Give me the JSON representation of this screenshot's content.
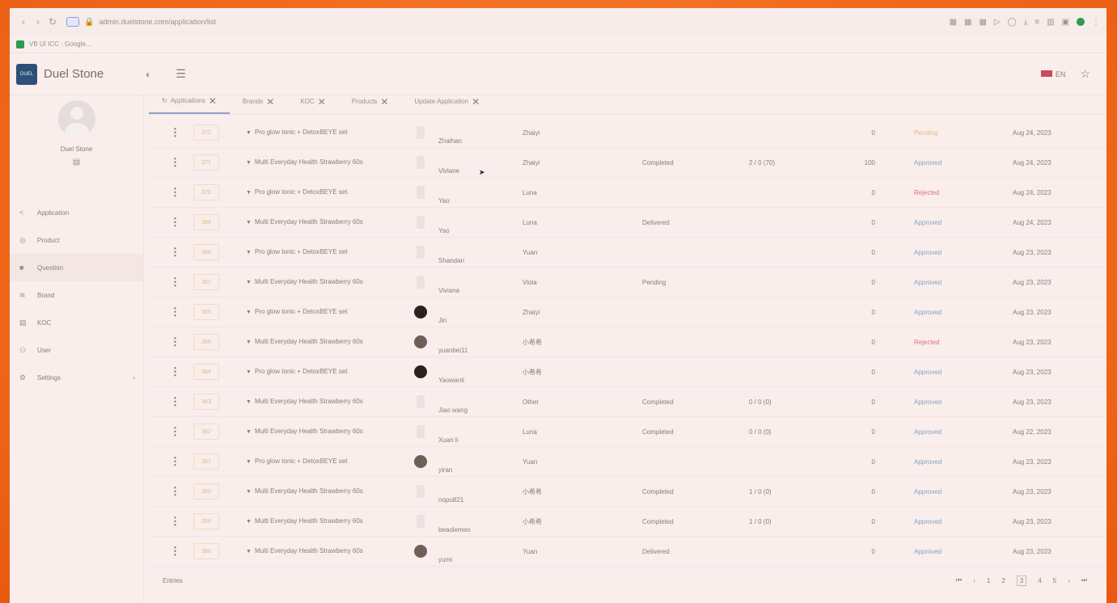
{
  "browser": {
    "url": "admin.duelstone.com/application/list",
    "bookmark": "VB UI ICC - Google..."
  },
  "app": {
    "name": "Duel Stone",
    "logo": "DUEL"
  },
  "header": {
    "lang": "EN"
  },
  "profile": {
    "name": "Duel Stone"
  },
  "sidebar": {
    "items": [
      {
        "label": "Application",
        "icon": "<"
      },
      {
        "label": "Product",
        "icon": "◎"
      },
      {
        "label": "Question",
        "icon": "■"
      },
      {
        "label": "Brand",
        "icon": "≋"
      },
      {
        "label": "KOC",
        "icon": "▤"
      },
      {
        "label": "User",
        "icon": "⚇"
      },
      {
        "label": "Settings",
        "icon": "⚙"
      }
    ]
  },
  "tabs": [
    "Applications",
    "Brands",
    "KOC",
    "Products",
    "Update Application"
  ],
  "rows": [
    {
      "id": "372",
      "product": "Pro glow tonic + DetoxBEYE set",
      "avatar": "bottle",
      "user": "Zhaihan",
      "agent": "Zhaiyi",
      "status": "",
      "progress": "",
      "count": "0",
      "approval": "Pending",
      "ap_class": "st-pending",
      "date": "Aug 24, 2023"
    },
    {
      "id": "371",
      "product": "Multi Everyday Health Strawberry 60s",
      "avatar": "bottle",
      "user": "Vivlane",
      "agent": "Zhaiyi",
      "status": "Completed",
      "progress": "2 / 0 (70)",
      "count": "100",
      "approval": "Approved",
      "ap_class": "st-approved",
      "date": "Aug 24, 2023"
    },
    {
      "id": "370",
      "product": "Pro glow tonic + DetoxBEYE set",
      "avatar": "bottle",
      "user": "Yao",
      "agent": "Luna",
      "status": "",
      "progress": "",
      "count": "0",
      "approval": "Rejected",
      "ap_class": "st-rejected",
      "date": "Aug 24, 2023"
    },
    {
      "id": "369",
      "product": "Multi Everyday Health Strawberry 60s",
      "avatar": "bottle",
      "user": "Yao",
      "agent": "Luna",
      "status": "Delivered",
      "progress": "",
      "count": "0",
      "approval": "Approved",
      "ap_class": "st-approved",
      "date": "Aug 24, 2023"
    },
    {
      "id": "368",
      "product": "Pro glow tonic + DetoxBEYE set",
      "avatar": "bottle",
      "user": "Shandan",
      "agent": "Yuan",
      "status": "",
      "progress": "",
      "count": "0",
      "approval": "Approved",
      "ap_class": "st-approved",
      "date": "Aug 23, 2023"
    },
    {
      "id": "367",
      "product": "Multi Everyday Health Strawberry 60s",
      "avatar": "bottle",
      "user": "Viviana",
      "agent": "Viola",
      "status": "Pending",
      "progress": "",
      "count": "0",
      "approval": "Approved",
      "ap_class": "st-approved",
      "date": "Aug 23, 2023"
    },
    {
      "id": "366",
      "product": "Pro glow tonic + DetoxBEYE set",
      "avatar": "dark",
      "user": "Jin",
      "agent": "Zhaiyi",
      "status": "",
      "progress": "",
      "count": "0",
      "approval": "Approved",
      "ap_class": "st-approved",
      "date": "Aug 23, 2023"
    },
    {
      "id": "365",
      "product": "Multi Everyday Health Strawberry 60s",
      "avatar": "photo",
      "user": "yuanbei11",
      "agent": "小希希",
      "status": "",
      "progress": "",
      "count": "0",
      "approval": "Rejected",
      "ap_class": "st-rejected",
      "date": "Aug 23, 2023"
    },
    {
      "id": "364",
      "product": "Pro glow tonic + DetoxBEYE set",
      "avatar": "dark",
      "user": "Yaowanli",
      "agent": "小希希",
      "status": "",
      "progress": "",
      "count": "0",
      "approval": "Approved",
      "ap_class": "st-approved",
      "date": "Aug 23, 2023"
    },
    {
      "id": "363",
      "product": "Multi Everyday Health Strawberry 60s",
      "avatar": "bottle",
      "user": "Jiao wang",
      "agent": "Other",
      "status": "Completed",
      "progress": "0 / 0 (0)",
      "count": "0",
      "approval": "Approved",
      "ap_class": "st-approved",
      "date": "Aug 23, 2023"
    },
    {
      "id": "362",
      "product": "Multi Everyday Health Strawberry 60s",
      "avatar": "bottle",
      "user": "Xuan li",
      "agent": "Luna",
      "status": "Completed",
      "progress": "0 / 0 (0)",
      "count": "0",
      "approval": "Approved",
      "ap_class": "st-approved",
      "date": "Aug 22, 2023"
    },
    {
      "id": "361",
      "product": "Pro glow tonic + DetoxBEYE set",
      "avatar": "photo",
      "user": "yiran",
      "agent": "Yuan",
      "status": "",
      "progress": "",
      "count": "0",
      "approval": "Approved",
      "ap_class": "st-approved",
      "date": "Aug 23, 2023"
    },
    {
      "id": "360",
      "product": "Multi Everyday Health Strawberry 60s",
      "avatar": "bottle",
      "user": "nopu821",
      "agent": "小希希",
      "status": "Completed",
      "progress": "1 / 0 (0)",
      "count": "0",
      "approval": "Approved",
      "ap_class": "st-approved",
      "date": "Aug 23, 2023"
    },
    {
      "id": "359",
      "product": "Multi Everyday Health Strawberry 60s",
      "avatar": "bottle",
      "user": "beaolemeo",
      "agent": "小希希",
      "status": "Completed",
      "progress": "1 / 0 (0)",
      "count": "0",
      "approval": "Approved",
      "ap_class": "st-approved",
      "date": "Aug 23, 2023"
    },
    {
      "id": "358",
      "product": "Multi Everyday Health Strawberry 60s",
      "avatar": "photo",
      "user": "yumi",
      "agent": "Yuan",
      "status": "Delivered",
      "progress": "",
      "count": "0",
      "approval": "Approved",
      "ap_class": "st-approved",
      "date": "Aug 23, 2023"
    }
  ],
  "footer": {
    "rows_label": "Entries"
  },
  "pager": {
    "pages": [
      "1",
      "2",
      "3",
      "4",
      "5"
    ],
    "current": "3"
  },
  "colors": {
    "accent": "#8fa0c8",
    "rejected": "#e0707a",
    "pending": "#e6b87a",
    "background": "#f26a1c"
  }
}
